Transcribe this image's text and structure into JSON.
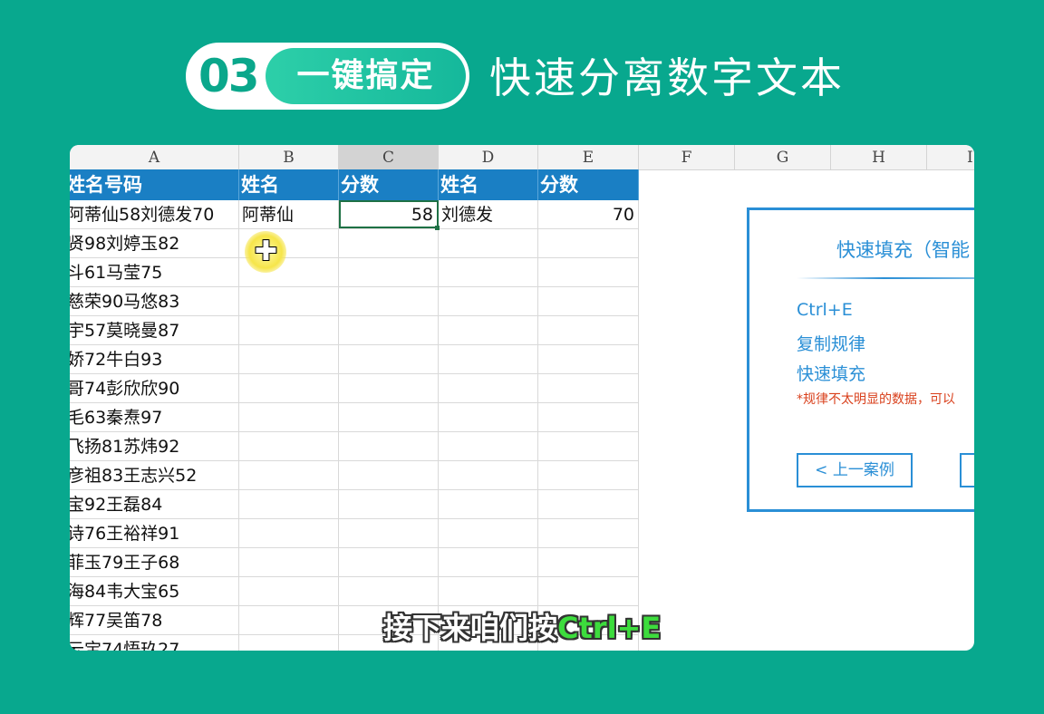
{
  "header": {
    "number": "03",
    "pill_label": "一键搞定",
    "title": "快速分离数字文本"
  },
  "spreadsheet": {
    "column_letters": [
      "A",
      "B",
      "C",
      "D",
      "E",
      "F",
      "G",
      "H",
      "I"
    ],
    "selected_column": "C",
    "header_row": [
      "姓名号码",
      "姓名",
      "分数",
      "姓名",
      "分数"
    ],
    "rows": [
      {
        "a": "阿蒂仙58刘德发70",
        "b": "阿蒂仙",
        "c": "58",
        "d": "刘德发",
        "e": "70"
      },
      {
        "a": "贤98刘婷玉82",
        "b": "",
        "c": "",
        "d": "",
        "e": ""
      },
      {
        "a": "斗61马莹75",
        "b": "",
        "c": "",
        "d": "",
        "e": ""
      },
      {
        "a": "慈荣90马悠83",
        "b": "",
        "c": "",
        "d": "",
        "e": ""
      },
      {
        "a": "宇57莫晓曼87",
        "b": "",
        "c": "",
        "d": "",
        "e": ""
      },
      {
        "a": "娇72牛白93",
        "b": "",
        "c": "",
        "d": "",
        "e": ""
      },
      {
        "a": "哥74彭欣欣90",
        "b": "",
        "c": "",
        "d": "",
        "e": ""
      },
      {
        "a": "毛63秦焘97",
        "b": "",
        "c": "",
        "d": "",
        "e": ""
      },
      {
        "a": "飞扬81苏炜92",
        "b": "",
        "c": "",
        "d": "",
        "e": ""
      },
      {
        "a": "彦祖83王志兴52",
        "b": "",
        "c": "",
        "d": "",
        "e": ""
      },
      {
        "a": "宝92王磊84",
        "b": "",
        "c": "",
        "d": "",
        "e": ""
      },
      {
        "a": "诗76王裕祥91",
        "b": "",
        "c": "",
        "d": "",
        "e": ""
      },
      {
        "a": "菲玉79王子68",
        "b": "",
        "c": "",
        "d": "",
        "e": ""
      },
      {
        "a": "海84韦大宝65",
        "b": "",
        "c": "",
        "d": "",
        "e": ""
      },
      {
        "a": "辉77吴笛78",
        "b": "",
        "c": "",
        "d": "",
        "e": ""
      },
      {
        "a": "云宝74悟玖27",
        "b": "",
        "c": "",
        "d": "",
        "e": ""
      }
    ]
  },
  "tip_panel": {
    "title": "快速填充（智能",
    "items": [
      "Ctrl+E",
      "复制规律",
      "快速填充"
    ],
    "note": "*规律不太明显的数据，可以",
    "prev_button": "< 上一案例"
  },
  "subtitle": {
    "text": "接下来咱们按",
    "highlight": "Ctrl+E"
  },
  "colors": {
    "background": "#08a88e",
    "table_header": "#1a7fc4",
    "panel_accent": "#2a8fd6",
    "note_red": "#d9401c",
    "subtitle_highlight": "#3ddc3d"
  }
}
